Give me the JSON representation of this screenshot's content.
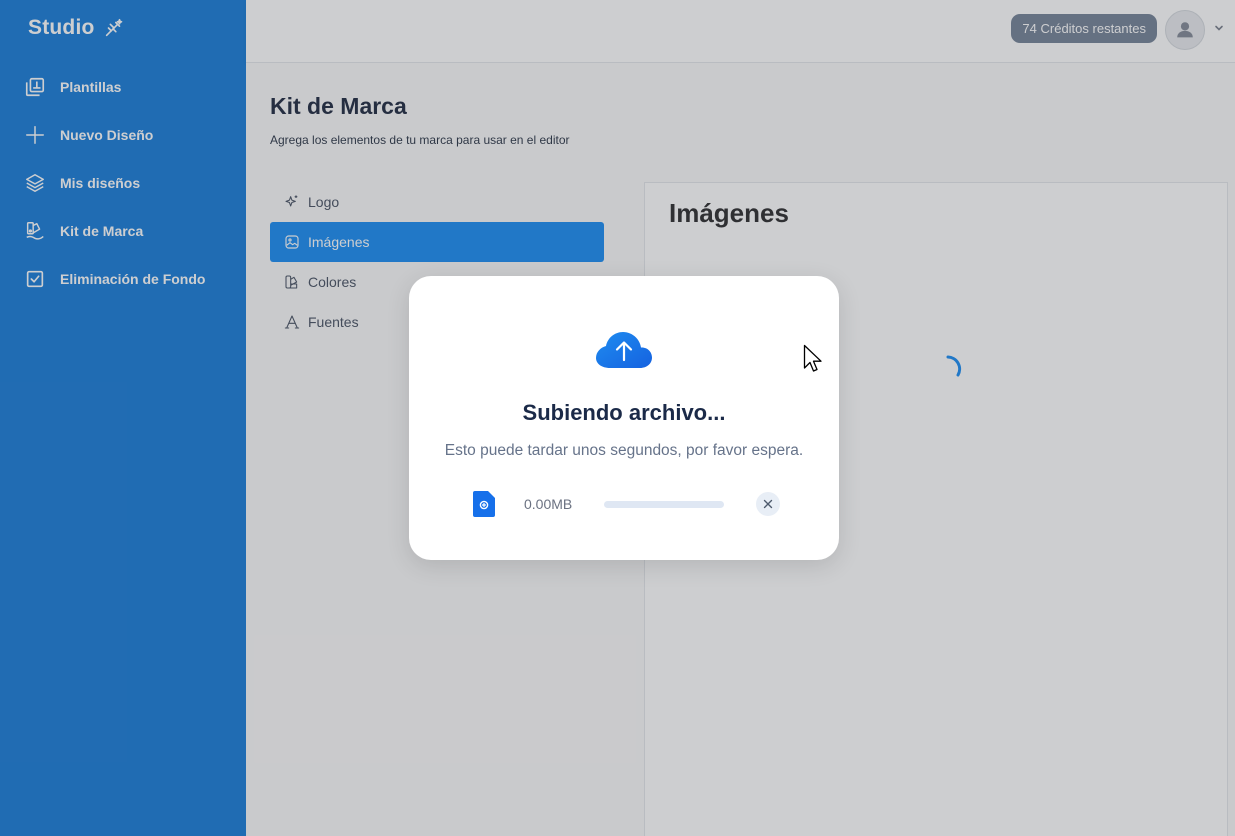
{
  "sidebar": {
    "brand": "Studio",
    "brand_icon": "magic-wand-icon",
    "items": [
      {
        "label": "Plantillas",
        "icon": "templates-icon"
      },
      {
        "label": "Nuevo Diseño",
        "icon": "plus-icon"
      },
      {
        "label": "Mis diseños",
        "icon": "layers-icon"
      },
      {
        "label": "Kit de Marca",
        "icon": "brand-kit-icon"
      },
      {
        "label": "Eliminación de Fondo",
        "icon": "checkbox-icon"
      }
    ]
  },
  "header": {
    "credits": "74 Créditos restantes",
    "avatar_icon": "user-icon",
    "menu_icon": "chevron-down-icon"
  },
  "main": {
    "title": "Kit de Marca",
    "subtitle": "Agrega los elementos de tu marca para usar en el editor",
    "tabs": [
      {
        "label": "Logo",
        "icon": "sparkle-icon",
        "active": false
      },
      {
        "label": "Imágenes",
        "icon": "image-icon",
        "active": true
      },
      {
        "label": "Colores",
        "icon": "palette-icon",
        "active": false
      },
      {
        "label": "Fuentes",
        "icon": "font-icon",
        "active": false
      }
    ],
    "panel_title": "Imágenes"
  },
  "modal": {
    "title": "Subiendo archivo...",
    "description": "Esto puede tardar unos segundos, por favor espera.",
    "file_size": "0.00MB",
    "progress": 0,
    "upload_icon": "cloud-upload-icon",
    "file_icon": "file-icon",
    "cancel_icon": "close-icon"
  },
  "colors": {
    "sidebar": "#0873d6",
    "accent": "#0a84f2",
    "credits_badge": "#6b7a90"
  }
}
